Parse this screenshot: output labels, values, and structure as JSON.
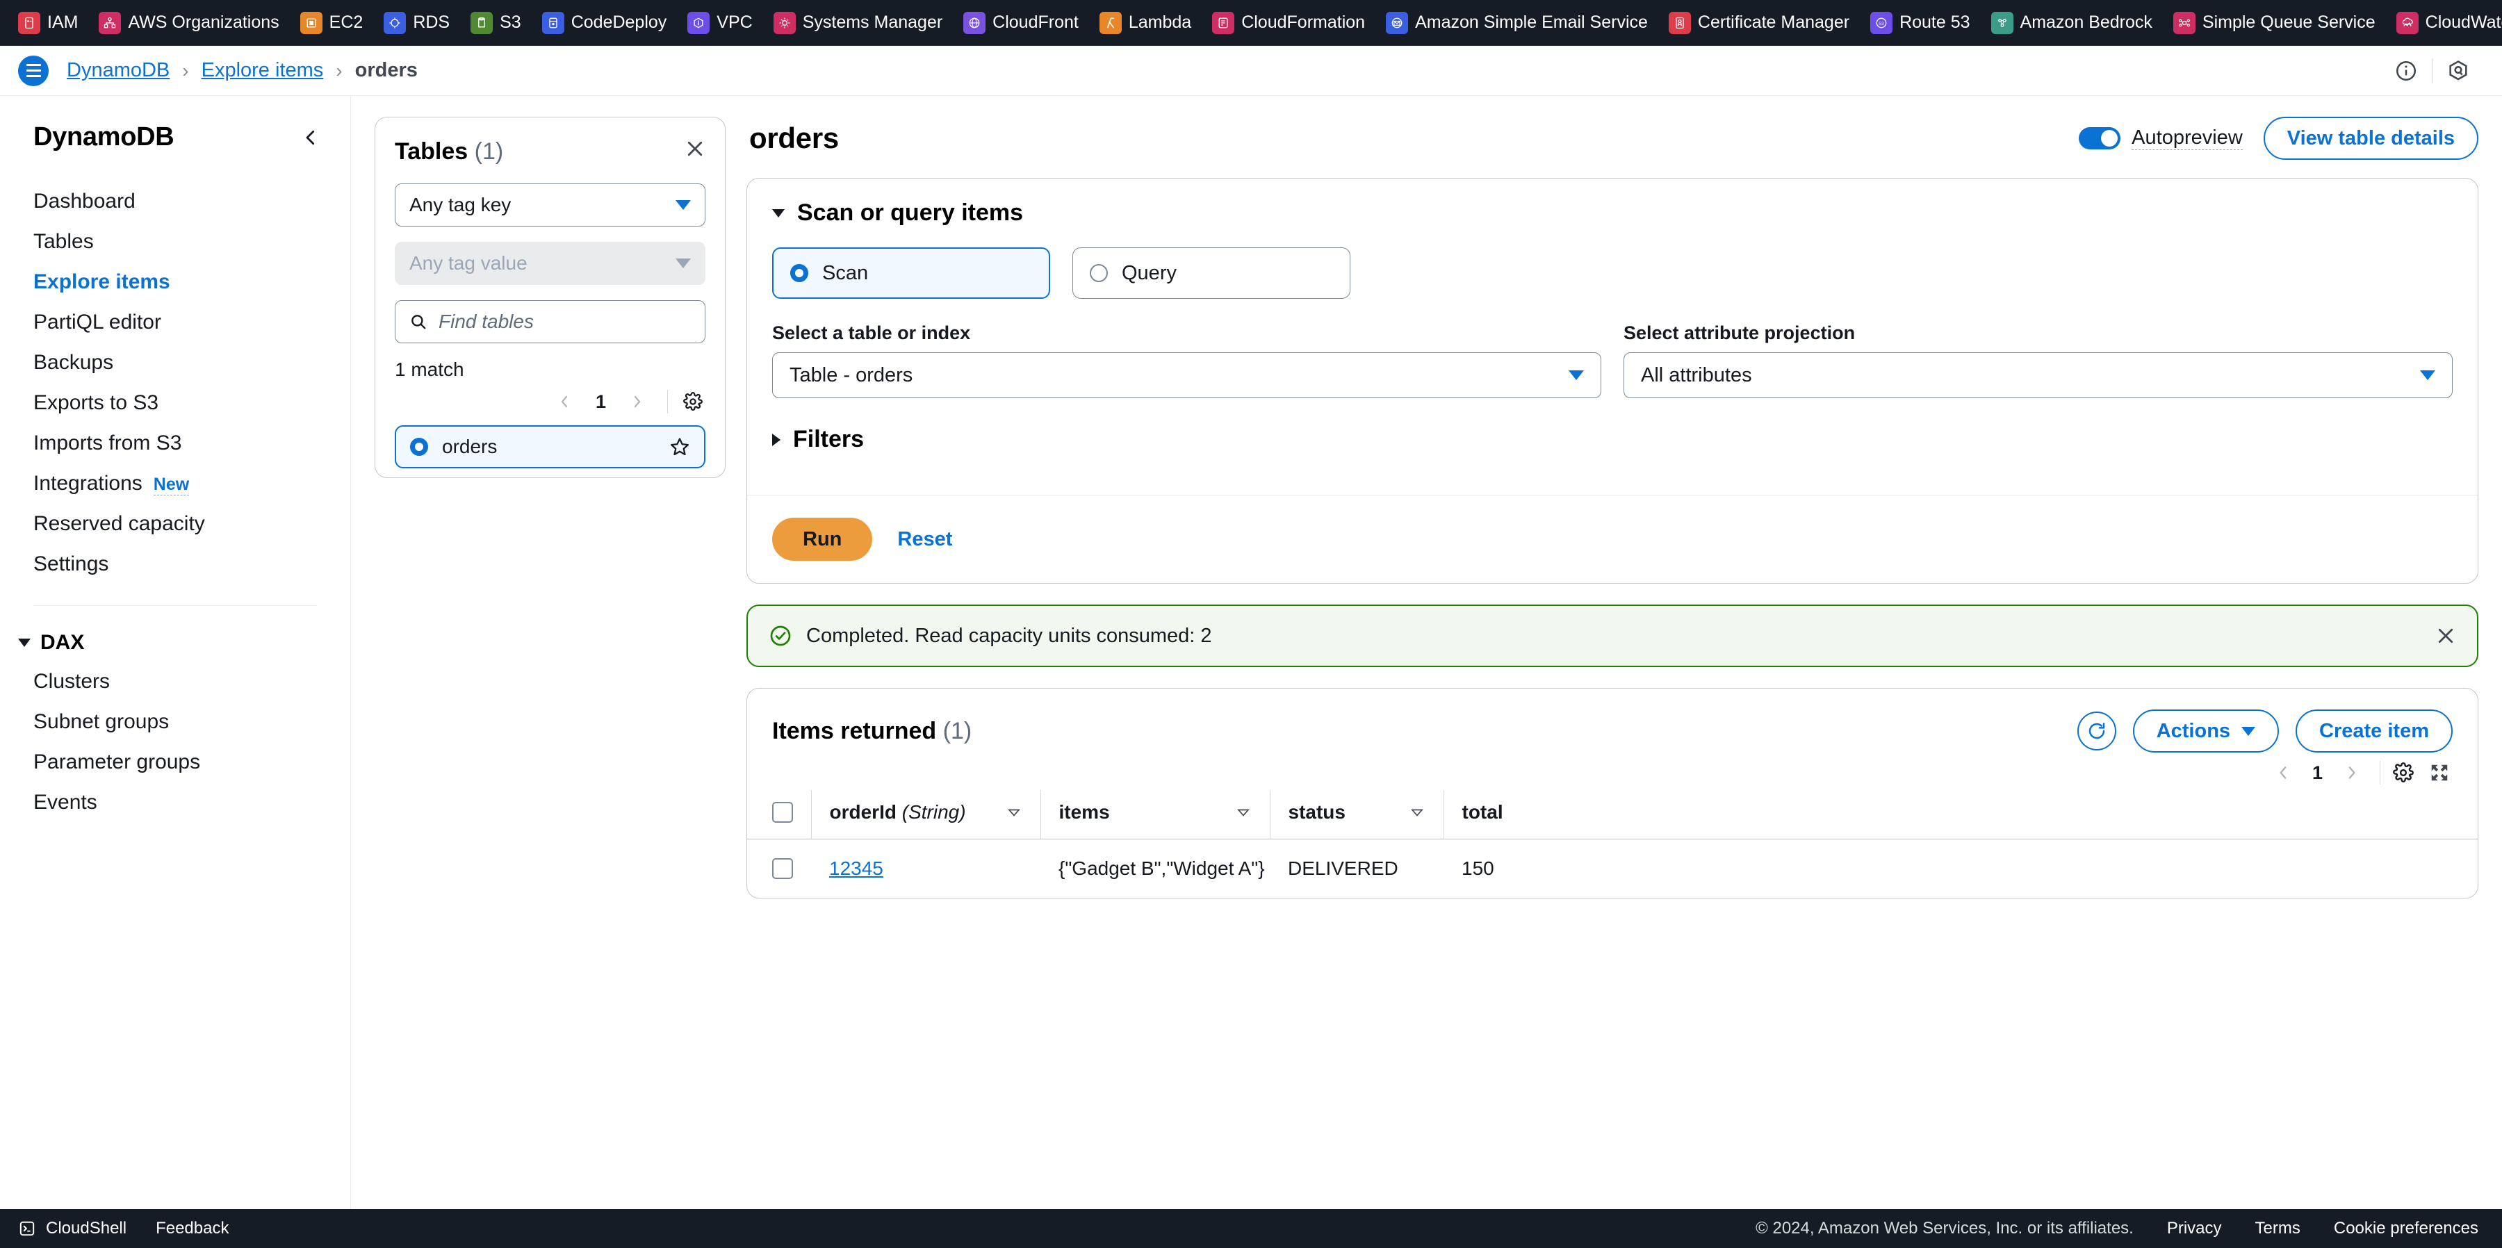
{
  "service_bar": [
    {
      "label": "IAM",
      "icon": "iam-icon",
      "color": "#dd3c4b"
    },
    {
      "label": "AWS Organizations",
      "icon": "organizations-icon",
      "color": "#cf2e63"
    },
    {
      "label": "EC2",
      "icon": "ec2-icon",
      "color": "#e8872a"
    },
    {
      "label": "RDS",
      "icon": "rds-icon",
      "color": "#3b5fe0"
    },
    {
      "label": "S3",
      "icon": "s3-icon",
      "color": "#4f8a32"
    },
    {
      "label": "CodeDeploy",
      "icon": "codedeploy-icon",
      "color": "#3b5fe0"
    },
    {
      "label": "VPC",
      "icon": "vpc-icon",
      "color": "#6b4fe8"
    },
    {
      "label": "Systems Manager",
      "icon": "systems-manager-icon",
      "color": "#cf2e63"
    },
    {
      "label": "CloudFront",
      "icon": "cloudfront-icon",
      "color": "#7a52e0"
    },
    {
      "label": "Lambda",
      "icon": "lambda-icon",
      "color": "#e8872a"
    },
    {
      "label": "CloudFormation",
      "icon": "cloudformation-icon",
      "color": "#cf2e63"
    },
    {
      "label": "Amazon Simple Email Service",
      "icon": "ses-icon",
      "color": "#3b5fe0"
    },
    {
      "label": "Certificate Manager",
      "icon": "certificate-manager-icon",
      "color": "#dd3c4b"
    },
    {
      "label": "Route 53",
      "icon": "route53-icon",
      "color": "#6b4fe8"
    },
    {
      "label": "Amazon Bedrock",
      "icon": "bedrock-icon",
      "color": "#3d9c87"
    },
    {
      "label": "Simple Queue Service",
      "icon": "sqs-icon",
      "color": "#cf2e63"
    },
    {
      "label": "CloudWatch",
      "icon": "cloudwatch-icon",
      "color": "#cf2e63"
    }
  ],
  "breadcrumb": {
    "items": [
      {
        "label": "DynamoDB",
        "link": true
      },
      {
        "label": "Explore items",
        "link": true
      },
      {
        "label": "orders",
        "link": false
      }
    ],
    "separator": "›"
  },
  "sidebar": {
    "title": "DynamoDB",
    "items": [
      {
        "label": "Dashboard",
        "active": false
      },
      {
        "label": "Tables",
        "active": false
      },
      {
        "label": "Explore items",
        "active": true
      },
      {
        "label": "PartiQL editor",
        "active": false
      },
      {
        "label": "Backups",
        "active": false
      },
      {
        "label": "Exports to S3",
        "active": false
      },
      {
        "label": "Imports from S3",
        "active": false
      },
      {
        "label": "Integrations",
        "active": false,
        "badge": "New"
      },
      {
        "label": "Reserved capacity",
        "active": false
      },
      {
        "label": "Settings",
        "active": false
      }
    ],
    "group": {
      "label": "DAX",
      "items": [
        {
          "label": "Clusters"
        },
        {
          "label": "Subnet groups"
        },
        {
          "label": "Parameter groups"
        },
        {
          "label": "Events"
        }
      ]
    }
  },
  "tables_panel": {
    "title": "Tables",
    "count": "(1)",
    "tag_key_value": "Any tag key",
    "tag_value_placeholder": "Any tag value",
    "find_placeholder": "Find tables",
    "match_text": "1 match",
    "page_number": "1",
    "table_item": "orders"
  },
  "main": {
    "page_title": "orders",
    "autopreview_label": "Autopreview",
    "autopreview_on": true,
    "view_table_details": "View table details",
    "scan_section": {
      "title": "Scan or query items",
      "expanded": true,
      "mode_scan": "Scan",
      "mode_query": "Query",
      "selected_mode": "Scan",
      "table_index_label": "Select a table or index",
      "table_index_value": "Table - orders",
      "projection_label": "Select attribute projection",
      "projection_value": "All attributes",
      "filters_label": "Filters",
      "filters_expanded": false,
      "run_label": "Run",
      "reset_label": "Reset"
    },
    "alert": {
      "message": "Completed. Read capacity units consumed: 2",
      "type": "success",
      "color": "#1d8102"
    },
    "results": {
      "title": "Items returned",
      "count": "(1)",
      "actions_label": "Actions",
      "create_item_label": "Create item",
      "page_number": "1",
      "columns": [
        {
          "label": "orderId",
          "type_suffix": " (String)",
          "sortable": true
        },
        {
          "label": "items",
          "type_suffix": "",
          "sortable": true
        },
        {
          "label": "status",
          "type_suffix": "",
          "sortable": true
        },
        {
          "label": "total",
          "type_suffix": "",
          "sortable": false
        }
      ],
      "rows": [
        {
          "orderId": "12345",
          "items": "{\"Gadget B\",\"Widget A\"}",
          "status": "DELIVERED",
          "total": "150"
        }
      ]
    }
  },
  "footer": {
    "cloudshell": "CloudShell",
    "feedback": "Feedback",
    "copyright": "© 2024, Amazon Web Services, Inc. or its affiliates.",
    "privacy": "Privacy",
    "terms": "Terms",
    "cookie_preferences": "Cookie preferences"
  }
}
